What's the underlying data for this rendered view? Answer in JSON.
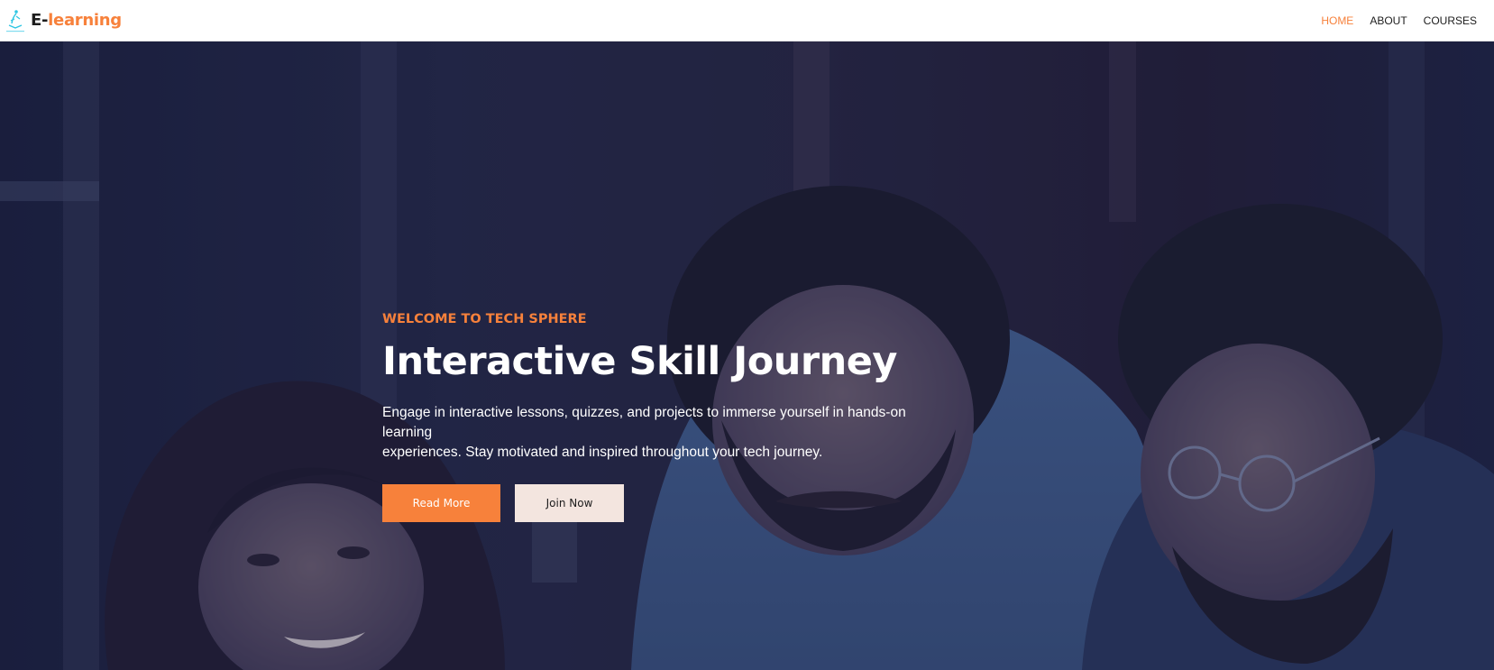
{
  "brand": {
    "prefix": "E-",
    "accent": "learning",
    "logo_icon": "book-reader-logo-icon"
  },
  "nav": {
    "items": [
      {
        "label": "HOME",
        "active": true
      },
      {
        "label": "ABOUT",
        "active": false
      },
      {
        "label": "COURSES",
        "active": false
      }
    ]
  },
  "hero": {
    "eyebrow": "WELCOME TO TECH SPHERE",
    "title": "Interactive Skill Journey",
    "line1": "Engage in interactive lessons, quizzes, and projects to immerse yourself in hands-on learning",
    "line2": "experiences. Stay motivated and inspired throughout your tech journey.",
    "primary_button": "Read More",
    "secondary_button": "Join Now"
  },
  "colors": {
    "accent": "#f7813b",
    "nav_text": "#1d1d1d",
    "secondary_button_bg": "#f3e5df",
    "hero_overlay": "#181d38"
  }
}
